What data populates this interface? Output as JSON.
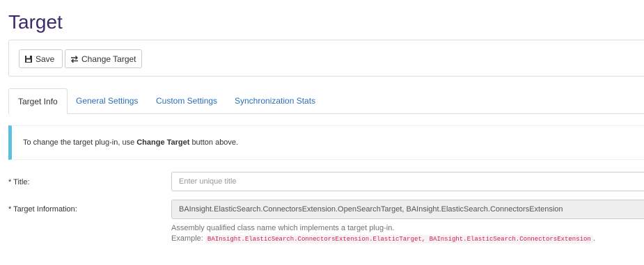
{
  "page": {
    "title": "Target"
  },
  "toolbar": {
    "save_label": "Save",
    "change_target_label": "Change Target"
  },
  "tabs": [
    {
      "label": "Target Info",
      "active": true
    },
    {
      "label": "General Settings",
      "active": false
    },
    {
      "label": "Custom Settings",
      "active": false
    },
    {
      "label": "Synchronization Stats",
      "active": false
    }
  ],
  "info": {
    "text_before": "To change the target plug-in, use",
    "bold": "Change Target",
    "text_after": "button above."
  },
  "form": {
    "title_label": "* Title:",
    "title_placeholder": "Enter unique title",
    "target_label": "* Target Information:",
    "target_value": "BAInsight.ElasticSearch.ConnectorsExtension.OpenSearchTarget,  BAInsight.ElasticSearch.ConnectorsExtension",
    "help_line1": "Assembly qualified class name which implements a target plug-in.",
    "example_label": "Example:",
    "example_code": "BAInsight.ElasticSearch.ConnectorsExtension.ElasticTarget, BAInsight.ElasticSearch.ConnectorsExtension",
    "example_end": "."
  },
  "icons": {
    "save": "save-icon",
    "change_target": "swap-icon"
  },
  "colors": {
    "title": "#3d2a6f",
    "link": "#2a6fb8",
    "info_accent": "#5bc0de",
    "code_text": "#c7254e"
  }
}
